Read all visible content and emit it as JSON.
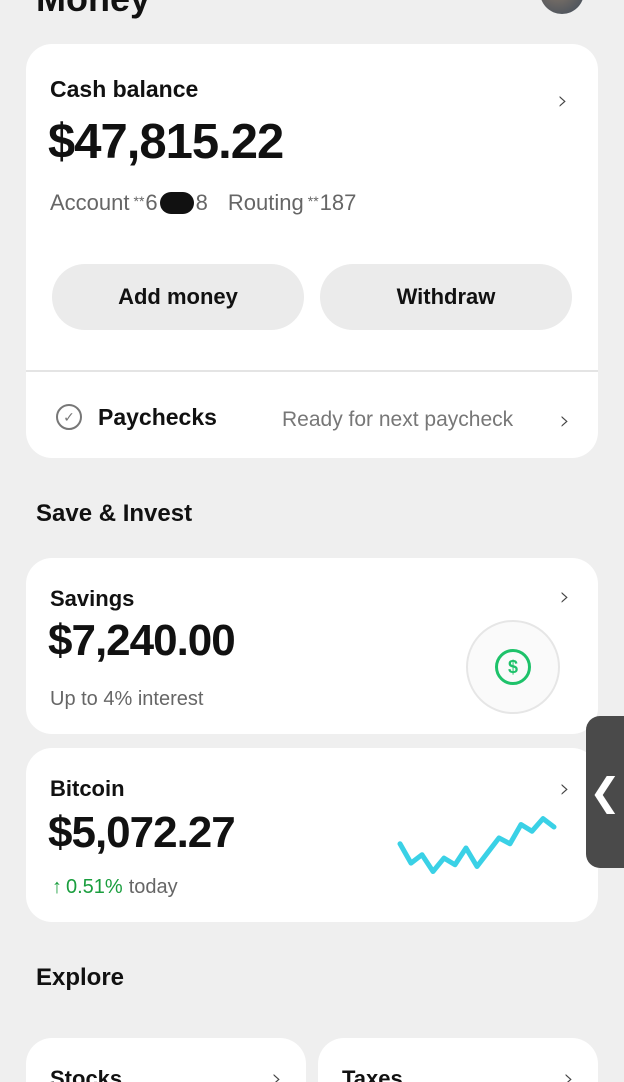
{
  "header": {
    "title": "Money"
  },
  "cash": {
    "label": "Cash balance",
    "amount": "$47,815.22",
    "account_label": "Account",
    "account_stars": "**",
    "account_prefix": "6",
    "account_suffix": "8",
    "routing_label": "Routing",
    "routing_stars": "**",
    "routing_digits": "187",
    "add_money_label": "Add money",
    "withdraw_label": "Withdraw",
    "paychecks_label": "Paychecks",
    "paychecks_status": "Ready for next paycheck"
  },
  "save_invest": {
    "title": "Save & Invest",
    "savings": {
      "label": "Savings",
      "amount": "$7,240.00",
      "subtitle": "Up to 4% interest",
      "icon_symbol": "$"
    },
    "bitcoin": {
      "label": "Bitcoin",
      "amount": "$5,072.27",
      "change": "0.51%",
      "change_suffix": "today",
      "sparkline_color": "#3ad1e6",
      "sparkline": [
        0.55,
        0.32,
        0.42,
        0.22,
        0.38,
        0.3,
        0.5,
        0.28,
        0.45,
        0.62,
        0.55,
        0.78,
        0.7,
        0.85,
        0.75
      ]
    }
  },
  "explore": {
    "title": "Explore",
    "cards": [
      "Stocks",
      "Taxes"
    ]
  },
  "icons": {
    "chevron": "›",
    "check": "✓",
    "up_arrow": "↑",
    "side_handle": "❮"
  },
  "colors": {
    "accent_green": "#1ec26a",
    "gain_green": "#1a9e3e",
    "background": "#efefef"
  }
}
